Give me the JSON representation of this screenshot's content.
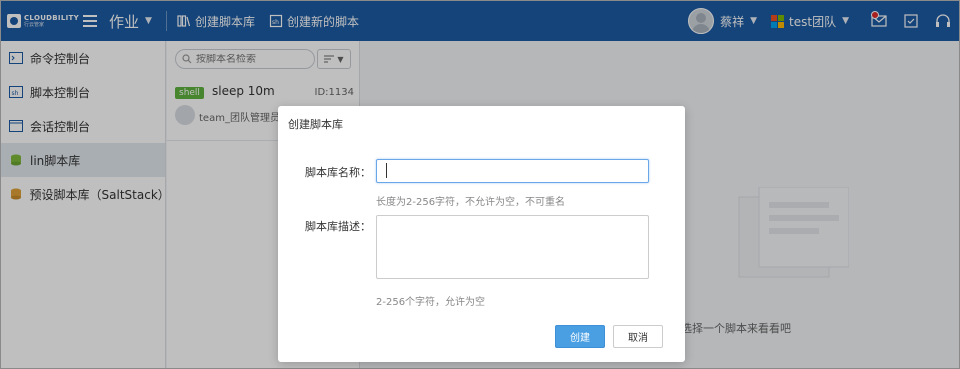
{
  "colors": {
    "topbar": "#1d5ba3",
    "primary_button": "#4a9fe3",
    "shell_tag": "#5fb33f",
    "notification_dot": "#e02b2b"
  },
  "header": {
    "logo_line1": "CLOUDBILITY",
    "logo_line2": "行云管家",
    "module": "作业",
    "create_library": "创建脚本库",
    "create_script": "创建新的脚本",
    "user_name": "蔡祥",
    "team_name": "test团队",
    "icons": [
      "menu-icon",
      "mail-icon",
      "task-icon",
      "headset-icon"
    ]
  },
  "sidebar": {
    "items": [
      {
        "label": "命令控制台",
        "icon": "terminal-icon"
      },
      {
        "label": "脚本控制台",
        "icon": "script-console-icon"
      },
      {
        "label": "会话控制台",
        "icon": "window-icon"
      },
      {
        "label": "lin脚本库",
        "icon": "database-icon",
        "active": true
      },
      {
        "label": "预设脚本库（SaltStack）",
        "icon": "database-icon"
      }
    ]
  },
  "list": {
    "search_placeholder": "按脚本名检索",
    "items": [
      {
        "tag": "shell",
        "name": "sleep 10m",
        "id": "ID:1134",
        "owner": "team_团队管理员1"
      }
    ]
  },
  "main": {
    "empty_text": "选择一个脚本来看看吧"
  },
  "dialog": {
    "title": "创建脚本库",
    "name_label": "脚本库名称：",
    "name_value": "",
    "name_hint": "长度为2-256字符，不允许为空，不可重名",
    "desc_label": "脚本库描述：",
    "desc_value": "",
    "desc_hint": "2-256个字符，允许为空",
    "ok_label": "创建",
    "cancel_label": "取消"
  }
}
